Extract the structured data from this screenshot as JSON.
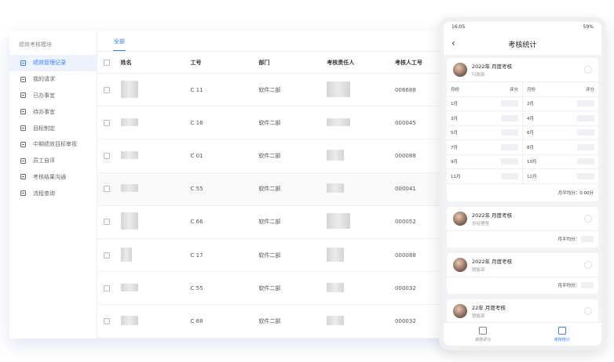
{
  "sidebar": {
    "title": "绩效考核模块",
    "items": [
      {
        "label": "绩效管理记录"
      },
      {
        "label": "我的请求"
      },
      {
        "label": "已办事宜"
      },
      {
        "label": "待办事宜"
      },
      {
        "label": "目标制定"
      },
      {
        "label": "中期绩效目标审视"
      },
      {
        "label": "员工自评"
      },
      {
        "label": "考核结果沟通"
      },
      {
        "label": "流程查询"
      }
    ]
  },
  "tabs": [
    {
      "label": "全部"
    }
  ],
  "table": {
    "headers": [
      "姓名",
      "工号",
      "部门",
      "考核责任人",
      "考核人工号"
    ],
    "rows": [
      {
        "id": "C  11",
        "dept": "软件二部",
        "mgr_id": "006688"
      },
      {
        "id": "C  16",
        "dept": "软件二部",
        "mgr_id": "000045"
      },
      {
        "id": "C  01",
        "dept": "软件二部",
        "mgr_id": "000088"
      },
      {
        "id": "C  55",
        "dept": "软件二部",
        "mgr_id": "000041"
      },
      {
        "id": "C  66",
        "dept": "软件二部",
        "mgr_id": "000052"
      },
      {
        "id": "C  17",
        "dept": "软件二部",
        "mgr_id": "000088"
      },
      {
        "id": "C  55",
        "dept": "软件二部",
        "mgr_id": "000032"
      },
      {
        "id": "C  88",
        "dept": "软件二部",
        "mgr_id": "000032"
      }
    ]
  },
  "phone": {
    "status_time": "16:05",
    "status_battery": "59%",
    "title": "考核统计",
    "cards": [
      {
        "title": "2022年 月度考核",
        "subtitle": "行政部",
        "month_header": "月份",
        "score_header": "评分",
        "months": [
          [
            "1月",
            "2月"
          ],
          [
            "3月",
            "4月"
          ],
          [
            "5月",
            "6月"
          ],
          [
            "7月",
            "8月"
          ],
          [
            "9月",
            "10月"
          ],
          [
            "11月",
            "12月"
          ]
        ],
        "avg_label": "月平均分：",
        "avg_value": "0.00分"
      },
      {
        "title": "2022年 月度考核",
        "subtitle": "总经理室",
        "avg_label": "月平均分："
      },
      {
        "title": "2022年 月度考核",
        "subtitle": "销售部",
        "avg_label": "月平均分："
      },
      {
        "title": "22年 月度考核",
        "subtitle": "销售部"
      }
    ],
    "tabbar": [
      {
        "label": "绩效评分"
      },
      {
        "label": "考核统计"
      }
    ]
  },
  "colors": {
    "accent": "#3a7bfd"
  },
  "icons": [
    "back-icon",
    "document-icon",
    "chart-icon"
  ]
}
